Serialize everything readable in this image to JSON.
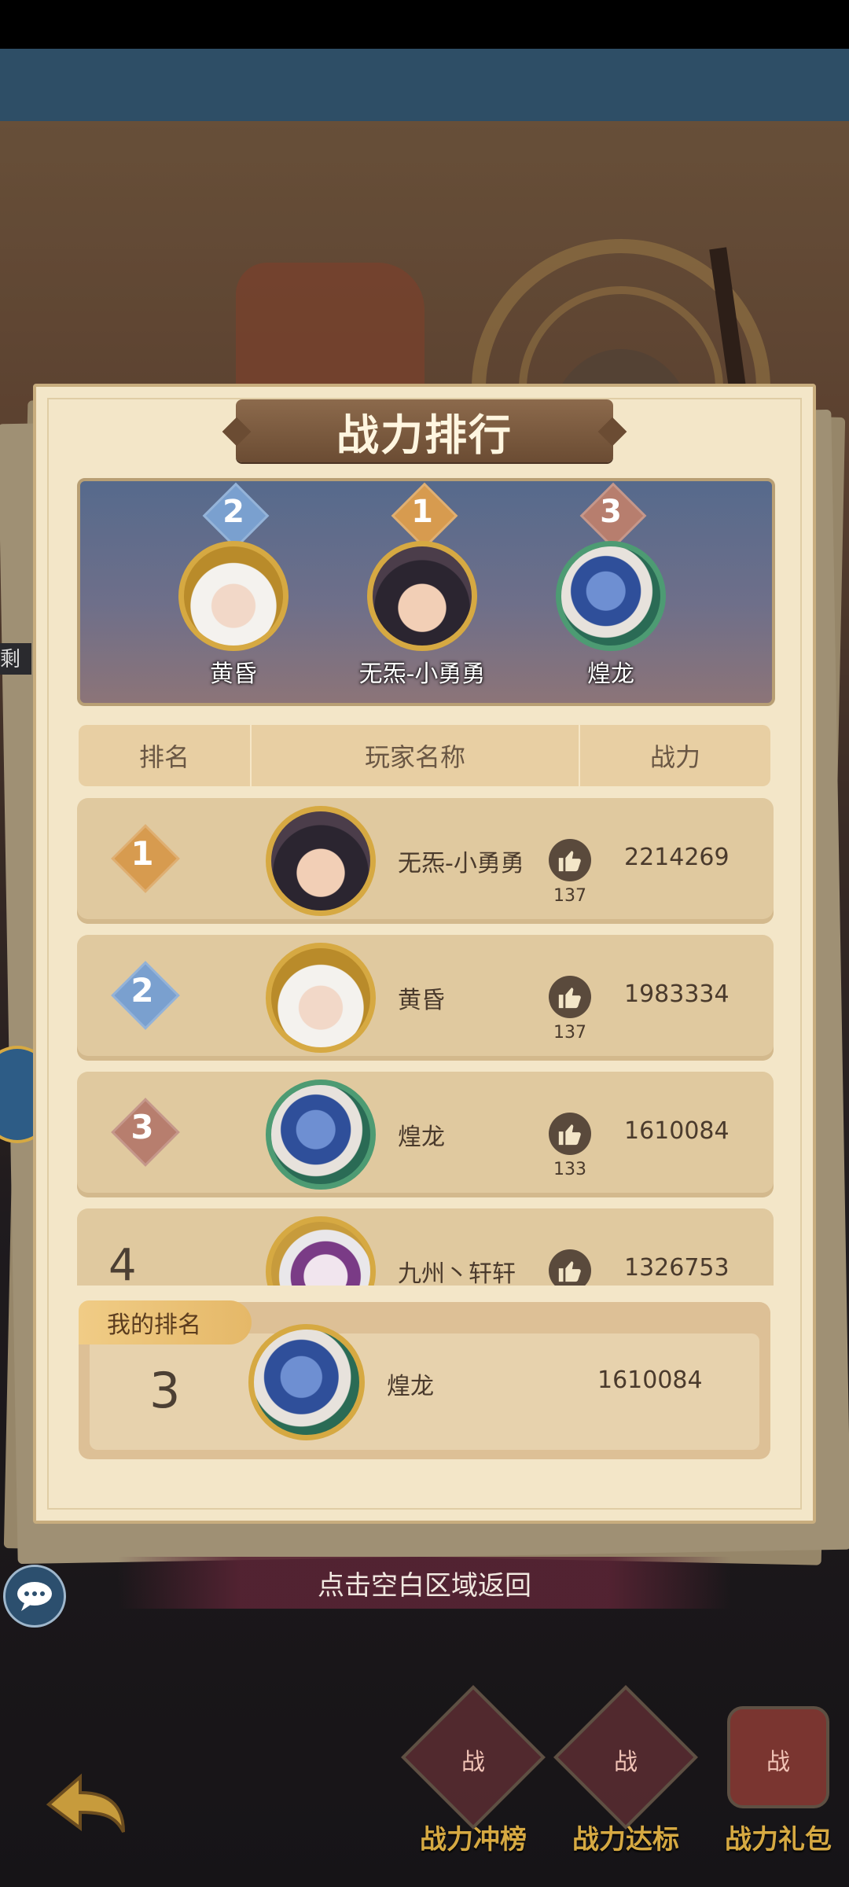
{
  "title": "战力排行",
  "podium": [
    {
      "rank": "2",
      "name": "黄昏",
      "color": "#7aa0cf"
    },
    {
      "rank": "1",
      "name": "无炁-小勇勇",
      "color": "#d79b4f"
    },
    {
      "rank": "3",
      "name": "煌龙",
      "color": "#b77e6e"
    }
  ],
  "table_headers": {
    "rank": "排名",
    "name": "玩家名称",
    "power": "战力"
  },
  "rows": [
    {
      "rank": "1",
      "name": "无炁-小勇勇",
      "likes": "137",
      "power": "2214269"
    },
    {
      "rank": "2",
      "name": "黄昏",
      "likes": "137",
      "power": "1983334"
    },
    {
      "rank": "3",
      "name": "煌龙",
      "likes": "133",
      "power": "1610084"
    },
    {
      "rank": "4",
      "name": "九州丶轩轩",
      "likes": "",
      "power": "1326753"
    }
  ],
  "my_rank": {
    "label": "我的排名",
    "rank": "3",
    "name": "煌龙",
    "power": "1610084"
  },
  "return_hint": "点击空白区域返回",
  "side_tag": "剩",
  "bottom_buttons": [
    {
      "label": "战力冲榜",
      "glyph": "战"
    },
    {
      "label": "战力达标",
      "glyph": "战"
    },
    {
      "label": "战力礼包",
      "glyph": "战"
    }
  ],
  "colors": {
    "gold": "#d6a942",
    "silver": "#7aa0cf",
    "bronze": "#b77e6e",
    "parchment": "#f3e6c8"
  }
}
